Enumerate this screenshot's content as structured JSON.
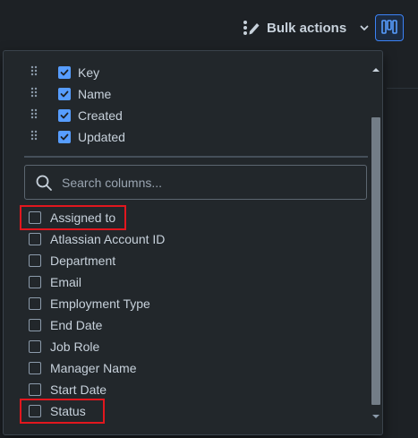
{
  "toolbar": {
    "bulk_actions_label": "Bulk actions"
  },
  "panel": {
    "pinned_columns": [
      {
        "label": "Key",
        "checked": true
      },
      {
        "label": "Name",
        "checked": true
      },
      {
        "label": "Created",
        "checked": true
      },
      {
        "label": "Updated",
        "checked": true
      }
    ],
    "search": {
      "placeholder": "Search columns...",
      "value": ""
    },
    "columns": [
      {
        "label": "Assigned to",
        "checked": false
      },
      {
        "label": "Atlassian Account ID",
        "checked": false
      },
      {
        "label": "Department",
        "checked": false
      },
      {
        "label": "Email",
        "checked": false
      },
      {
        "label": "Employment Type",
        "checked": false
      },
      {
        "label": "End Date",
        "checked": false
      },
      {
        "label": "Job Role",
        "checked": false
      },
      {
        "label": "Manager Name",
        "checked": false
      },
      {
        "label": "Start Date",
        "checked": false
      },
      {
        "label": "Status",
        "checked": false
      }
    ],
    "highlighted": [
      "Assigned to",
      "Status"
    ]
  },
  "colors": {
    "background": "#1d2125",
    "panel": "#22272b",
    "accent": "#579dff",
    "highlight": "#e2171e"
  },
  "icons": {
    "drag": "drag-handle-icon",
    "bulk": "bulk-actions-icon",
    "chevron": "chevron-down-icon",
    "view": "column-view-icon",
    "search": "search-icon"
  }
}
